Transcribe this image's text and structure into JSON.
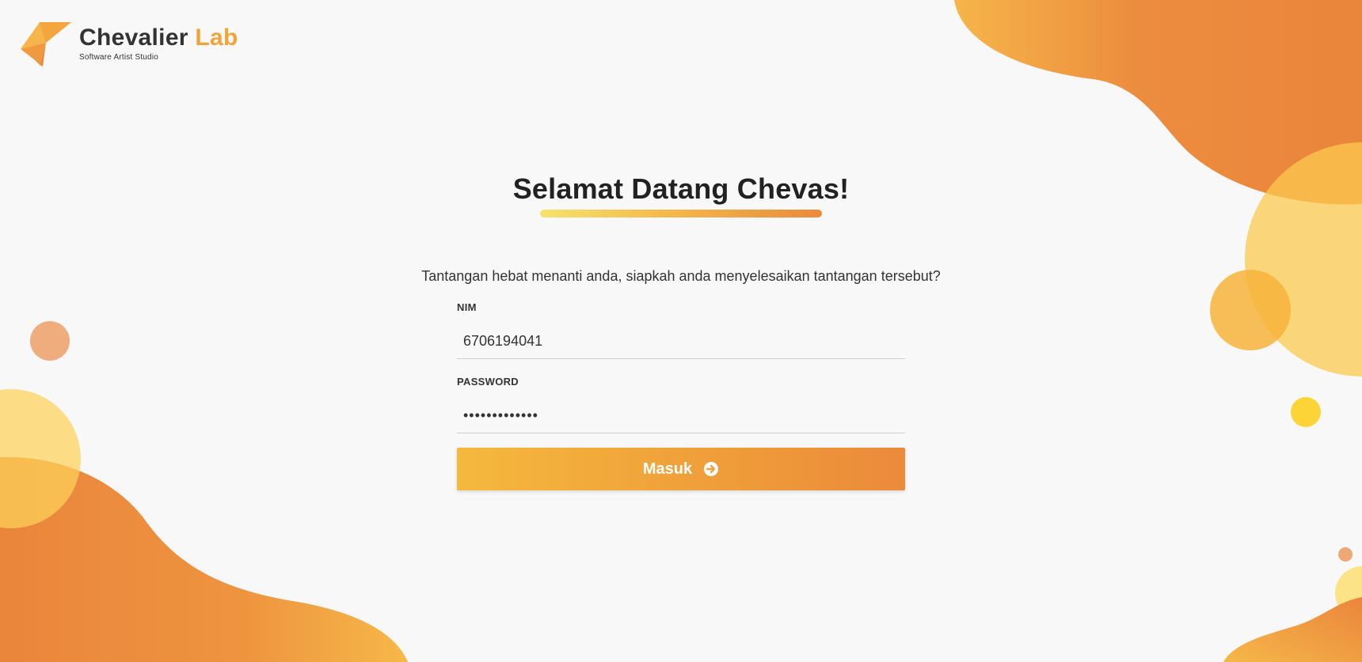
{
  "brand": {
    "name_main": "Chevalier",
    "name_accent": "Lab",
    "tagline": "Software Artist Studio"
  },
  "welcome": {
    "title": "Selamat Datang Chevas!",
    "subtitle": "Tantangan hebat menanti anda, siapkah anda menyelesaikan tantangan tersebut?"
  },
  "form": {
    "nim_label": "NIM",
    "nim_value": "6706194041",
    "password_label": "PASSWORD",
    "password_value": "•••••••••••••",
    "submit_label": "Masuk"
  },
  "colors": {
    "accent_orange": "#eb8a3b",
    "accent_yellow": "#f5b93d",
    "light_yellow": "#fde07a",
    "background": "#f8f8f8"
  },
  "icons": {
    "submit": "arrow-circle-right-icon"
  }
}
